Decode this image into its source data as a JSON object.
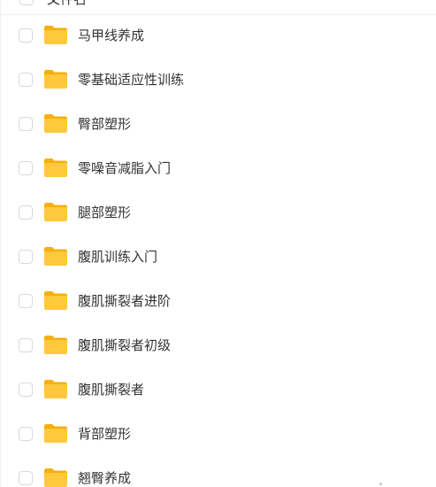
{
  "header": {
    "label": "文件名"
  },
  "files": [
    {
      "name": "马甲线养成",
      "icon": "folder-icon"
    },
    {
      "name": "零基础适应性训练",
      "icon": "folder-icon"
    },
    {
      "name": "臀部塑形",
      "icon": "folder-icon"
    },
    {
      "name": "零噪音减脂入门",
      "icon": "folder-icon"
    },
    {
      "name": "腿部塑形",
      "icon": "folder-icon"
    },
    {
      "name": "腹肌训练入门",
      "icon": "folder-icon"
    },
    {
      "name": "腹肌撕裂者进阶",
      "icon": "folder-icon"
    },
    {
      "name": "腹肌撕裂者初级",
      "icon": "folder-icon"
    },
    {
      "name": "腹肌撕裂者",
      "icon": "folder-icon"
    },
    {
      "name": "背部塑形",
      "icon": "folder-icon"
    },
    {
      "name": "翘臀养成",
      "icon": "folder-icon"
    }
  ],
  "colors": {
    "folder_front": "#FFC83D",
    "folder_back": "#F5B00A",
    "text": "#333333",
    "checkbox_border": "#d9d9d9"
  }
}
